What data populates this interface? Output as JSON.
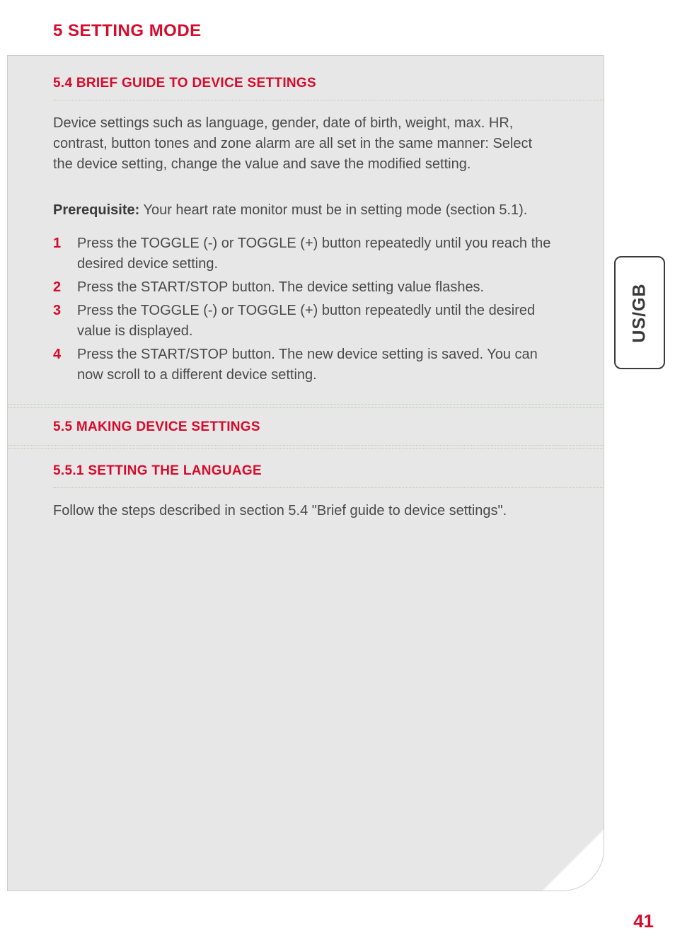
{
  "chapter_title": "5 SETTING MODE",
  "section_5_4": {
    "heading": "5.4 BRIEF GUIDE TO DEVICE SETTINGS",
    "para1": "Device settings such as language, gender, date of birth, weight, max. HR, contrast, button tones and zone alarm are all set in the same manner: Select the device setting, change the value and save the modified setting.",
    "prereq_label": "Prerequisite:",
    "prereq_text": " Your heart rate monitor must be in setting mode (section 5.1).",
    "steps": [
      "Press the TOGGLE (-) or TOGGLE (+) button repeatedly until you reach the desired device setting.",
      "Press the START/STOP button. The device setting value flashes.",
      "Press the TOGGLE (-) or TOGGLE (+) button repeatedly until the desired value is displayed.",
      "Press the START/STOP button. The new device setting is saved. You can now scroll to a different device setting."
    ]
  },
  "section_5_5": {
    "heading": "5.5 MAKING DEVICE SETTINGS"
  },
  "section_5_5_1": {
    "heading": "5.5.1 SETTING THE LANGUAGE",
    "para": "Follow the steps described in section 5.4 \"Brief guide to device settings\"."
  },
  "side_tab": "US/GB",
  "page_number": "41"
}
